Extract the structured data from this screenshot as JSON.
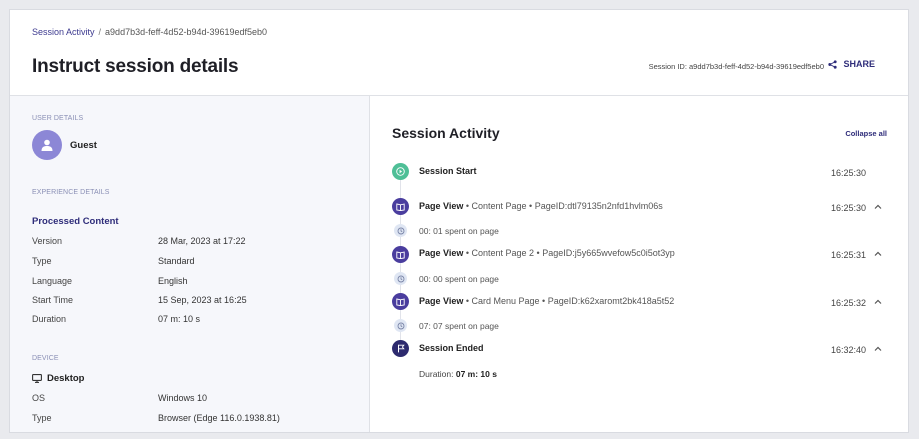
{
  "breadcrumb": {
    "parent": "Session Activity",
    "separator": "/",
    "current": "a9dd7b3d-feff-4d52-b94d-39619edf5eb0"
  },
  "header": {
    "title": "Instruct session details",
    "session_id_text": "Session ID: a9dd7b3d-feff-4d52-b94d-39619edf5eb0",
    "share_label": "SHARE"
  },
  "user": {
    "section_label": "USER DETAILS",
    "name": "Guest"
  },
  "experience": {
    "section_label": "EXPERIENCE DETAILS",
    "name": "Processed Content",
    "rows": [
      {
        "label": "Version",
        "value": "28 Mar, 2023 at 17:22"
      },
      {
        "label": "Type",
        "value": "Standard"
      },
      {
        "label": "Language",
        "value": "English"
      },
      {
        "label": "Start Time",
        "value": "15 Sep, 2023 at 16:25"
      },
      {
        "label": "Duration",
        "value": "07 m: 10 s"
      }
    ]
  },
  "device": {
    "section_label": "DEVICE",
    "name": "Desktop",
    "rows": [
      {
        "label": "OS",
        "value": "Windows 10"
      },
      {
        "label": "Type",
        "value": "Browser (Edge 116.0.1938.81)"
      }
    ]
  },
  "activity": {
    "title": "Session Activity",
    "collapse_label": "Collapse all",
    "events": [
      {
        "title": "Session Start",
        "meta": "",
        "time": "16:25:30"
      },
      {
        "title": "Page View",
        "meta": " • Content Page • PageID:dtl79135n2nfd1hvlm06s",
        "time": "16:25:30",
        "sub": "00: 01 spent on page"
      },
      {
        "title": "Page View",
        "meta": " • Content Page 2 • PageID:j5y665wvefow5c0i5ot3yp",
        "time": "16:25:31",
        "sub": "00: 00 spent on page"
      },
      {
        "title": "Page View",
        "meta": " • Card Menu Page • PageID:k62xaromt2bk418a5t52",
        "time": "16:25:32",
        "sub": "07: 07 spent on page"
      },
      {
        "title": "Session Ended",
        "meta": "",
        "time": "16:32:40"
      }
    ],
    "duration_label": "Duration: ",
    "duration_value": "07 m: 10 s"
  },
  "colors": {
    "accent": "#2f2d7a",
    "avatar": "#8c87d6",
    "start_icon": "#4fbf97",
    "page_icon": "#4a3d9e",
    "end_icon": "#2d2a6e"
  }
}
